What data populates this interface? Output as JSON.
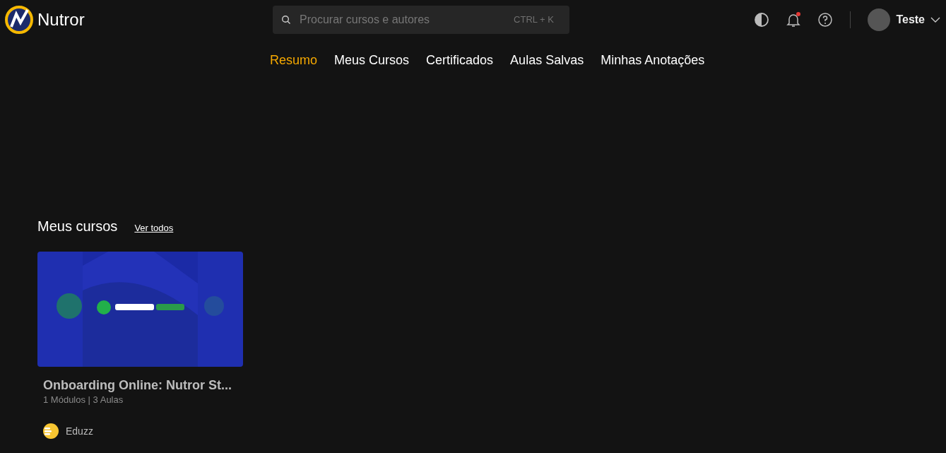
{
  "brand": {
    "name": "Nutror"
  },
  "search": {
    "placeholder": "Procurar cursos e autores",
    "shortcut": "CTRL + K"
  },
  "notifications": {
    "unread": true
  },
  "user": {
    "name": "Teste"
  },
  "tabs": [
    {
      "label": "Resumo",
      "selected": true
    },
    {
      "label": "Meus Cursos",
      "selected": false
    },
    {
      "label": "Certificados",
      "selected": false
    },
    {
      "label": "Aulas Salvas",
      "selected": false
    },
    {
      "label": "Minhas Anotações",
      "selected": false
    }
  ],
  "section": {
    "title": "Meus cursos",
    "link": "Ver todos"
  },
  "courses": [
    {
      "kind": "picture",
      "title": "Onboarding Online: Nutror St...",
      "meta": "1 Módulos | 3 Aulas",
      "producer": "Eduzz"
    }
  ]
}
